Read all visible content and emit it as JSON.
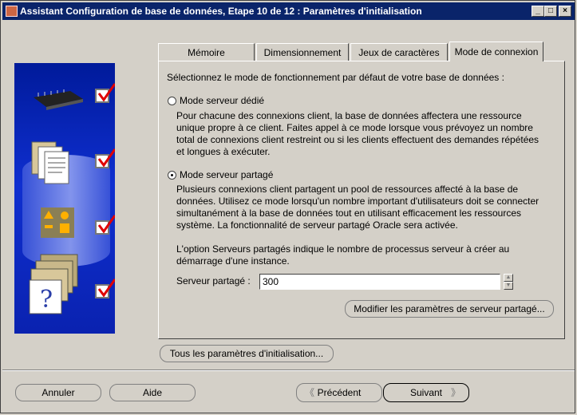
{
  "window": {
    "title": "Assistant Configuration de base de données, Etape 10 de 12 : Paramètres d'initialisation",
    "controls": [
      "_",
      "□",
      "×"
    ]
  },
  "tabs": [
    {
      "label": "Mémoire",
      "active": false
    },
    {
      "label": "Dimensionnement",
      "active": false
    },
    {
      "label": "Jeux de caractères",
      "active": false
    },
    {
      "label": "Mode de connexion",
      "active": true
    }
  ],
  "panel": {
    "intro": "Sélectionnez le mode de fonctionnement par défaut de votre base de données :",
    "dedicated": {
      "label": "Mode serveur dédié",
      "selected": false,
      "lines": [
        "Pour chacune des connexions client, la base de données affectera une ressource",
        "unique propre à ce client. Faites appel à ce mode lorsque vous prévoyez un nombre",
        "total de connexions client restreint ou si les clients effectuent des demandes répétées",
        "et longues à exécuter."
      ]
    },
    "shared": {
      "label": "Mode serveur partagé",
      "selected": true,
      "lines": [
        "Plusieurs connexions client partagent un pool de ressources affecté à la base de",
        "données. Utilisez ce mode lorsqu'un nombre important d'utilisateurs doit se connecter",
        "simultanément à la base de données tout en utilisant efficacement les ressources",
        "système. La fonctionnalité de serveur partagé Oracle sera activée."
      ],
      "option_lines": [
        "L'option Serveurs partagés indique le nombre de processus serveur à créer au",
        "démarrage d'une instance."
      ],
      "field_label": "Serveur partagé :",
      "field_value": "300",
      "modify_button": "Modifier les paramètres de serveur partagé..."
    }
  },
  "all_params_button": "Tous les paramètres d'initialisation...",
  "footer": {
    "cancel": "Annuler",
    "help": "Aide",
    "back": "Précédent",
    "next": "Suivant"
  },
  "steps": [
    {
      "icon": "memory-chip-icon",
      "checked": true
    },
    {
      "icon": "documents-icon",
      "checked": true
    },
    {
      "icon": "shapes-icon",
      "checked": true
    },
    {
      "icon": "help-folder-icon",
      "checked": true
    }
  ],
  "colors": {
    "titlebar": "#0a246a",
    "panel_bg": "#0f2fd0",
    "check": "#e00000"
  }
}
